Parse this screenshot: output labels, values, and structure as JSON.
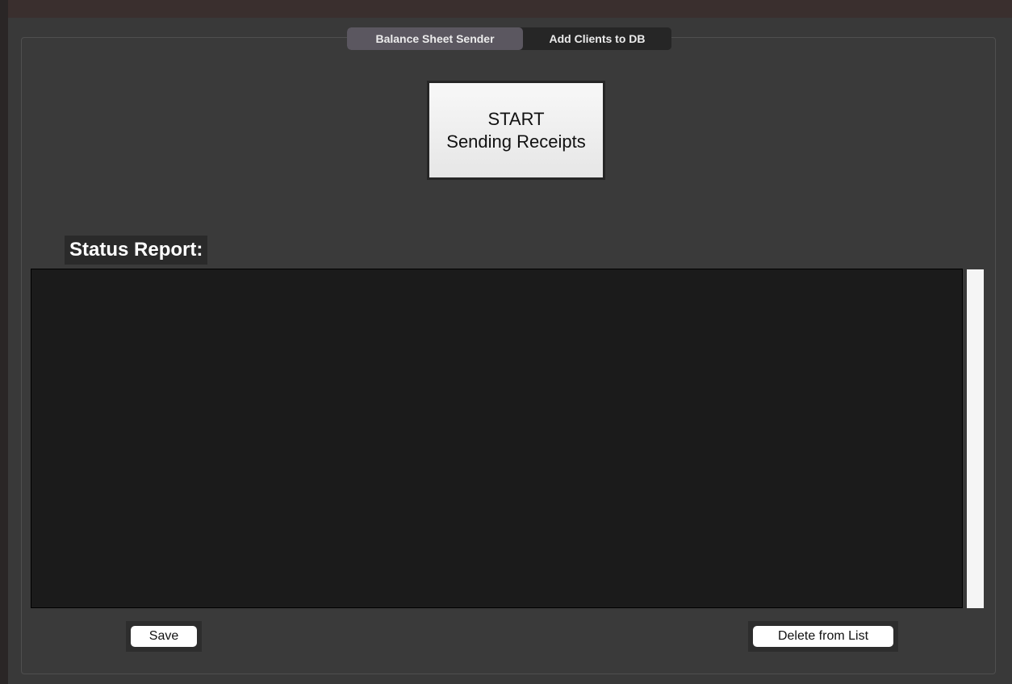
{
  "tabs": {
    "active_label": "Balance Sheet Sender",
    "inactive_label": "Add Clients to DB"
  },
  "start_button": {
    "line1": "START",
    "line2": "Sending Receipts"
  },
  "status": {
    "label": "Status Report:"
  },
  "buttons": {
    "save": "Save",
    "delete": "Delete from List"
  }
}
